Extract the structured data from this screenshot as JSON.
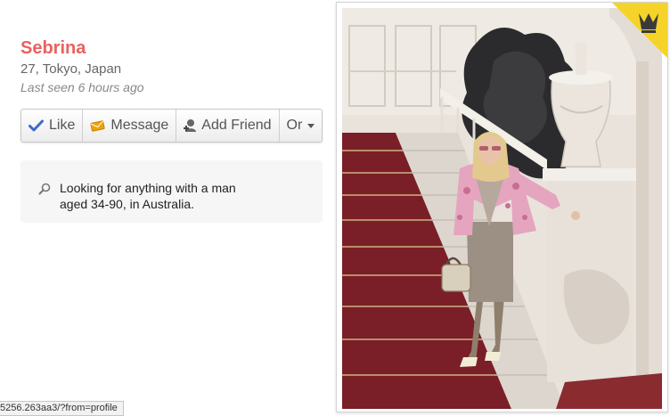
{
  "profile": {
    "name": "Sebrina",
    "details": "27, Tokyo, Japan",
    "last_seen": "Last seen 6 hours ago"
  },
  "actions": [
    {
      "label": "Like",
      "icon": "check-icon"
    },
    {
      "label": "Message",
      "icon": "envelope-icon"
    },
    {
      "label": "Add Friend",
      "icon": "add-friend-icon"
    },
    {
      "label": "Or",
      "icon": "chevron-down-icon"
    }
  ],
  "looking_for": {
    "icon": "search-icon",
    "text": "Looking for anything with a man aged 34-90, in Australia."
  },
  "status_bar": {
    "url": "5256.263aa3/?from=profile"
  },
  "photo": {
    "badge_icon": "crown-icon"
  },
  "colors": {
    "name": "#e8625f",
    "like_check": "#3b6cc8",
    "message_icon": "#f0a30a",
    "badge": "#f5d329"
  }
}
